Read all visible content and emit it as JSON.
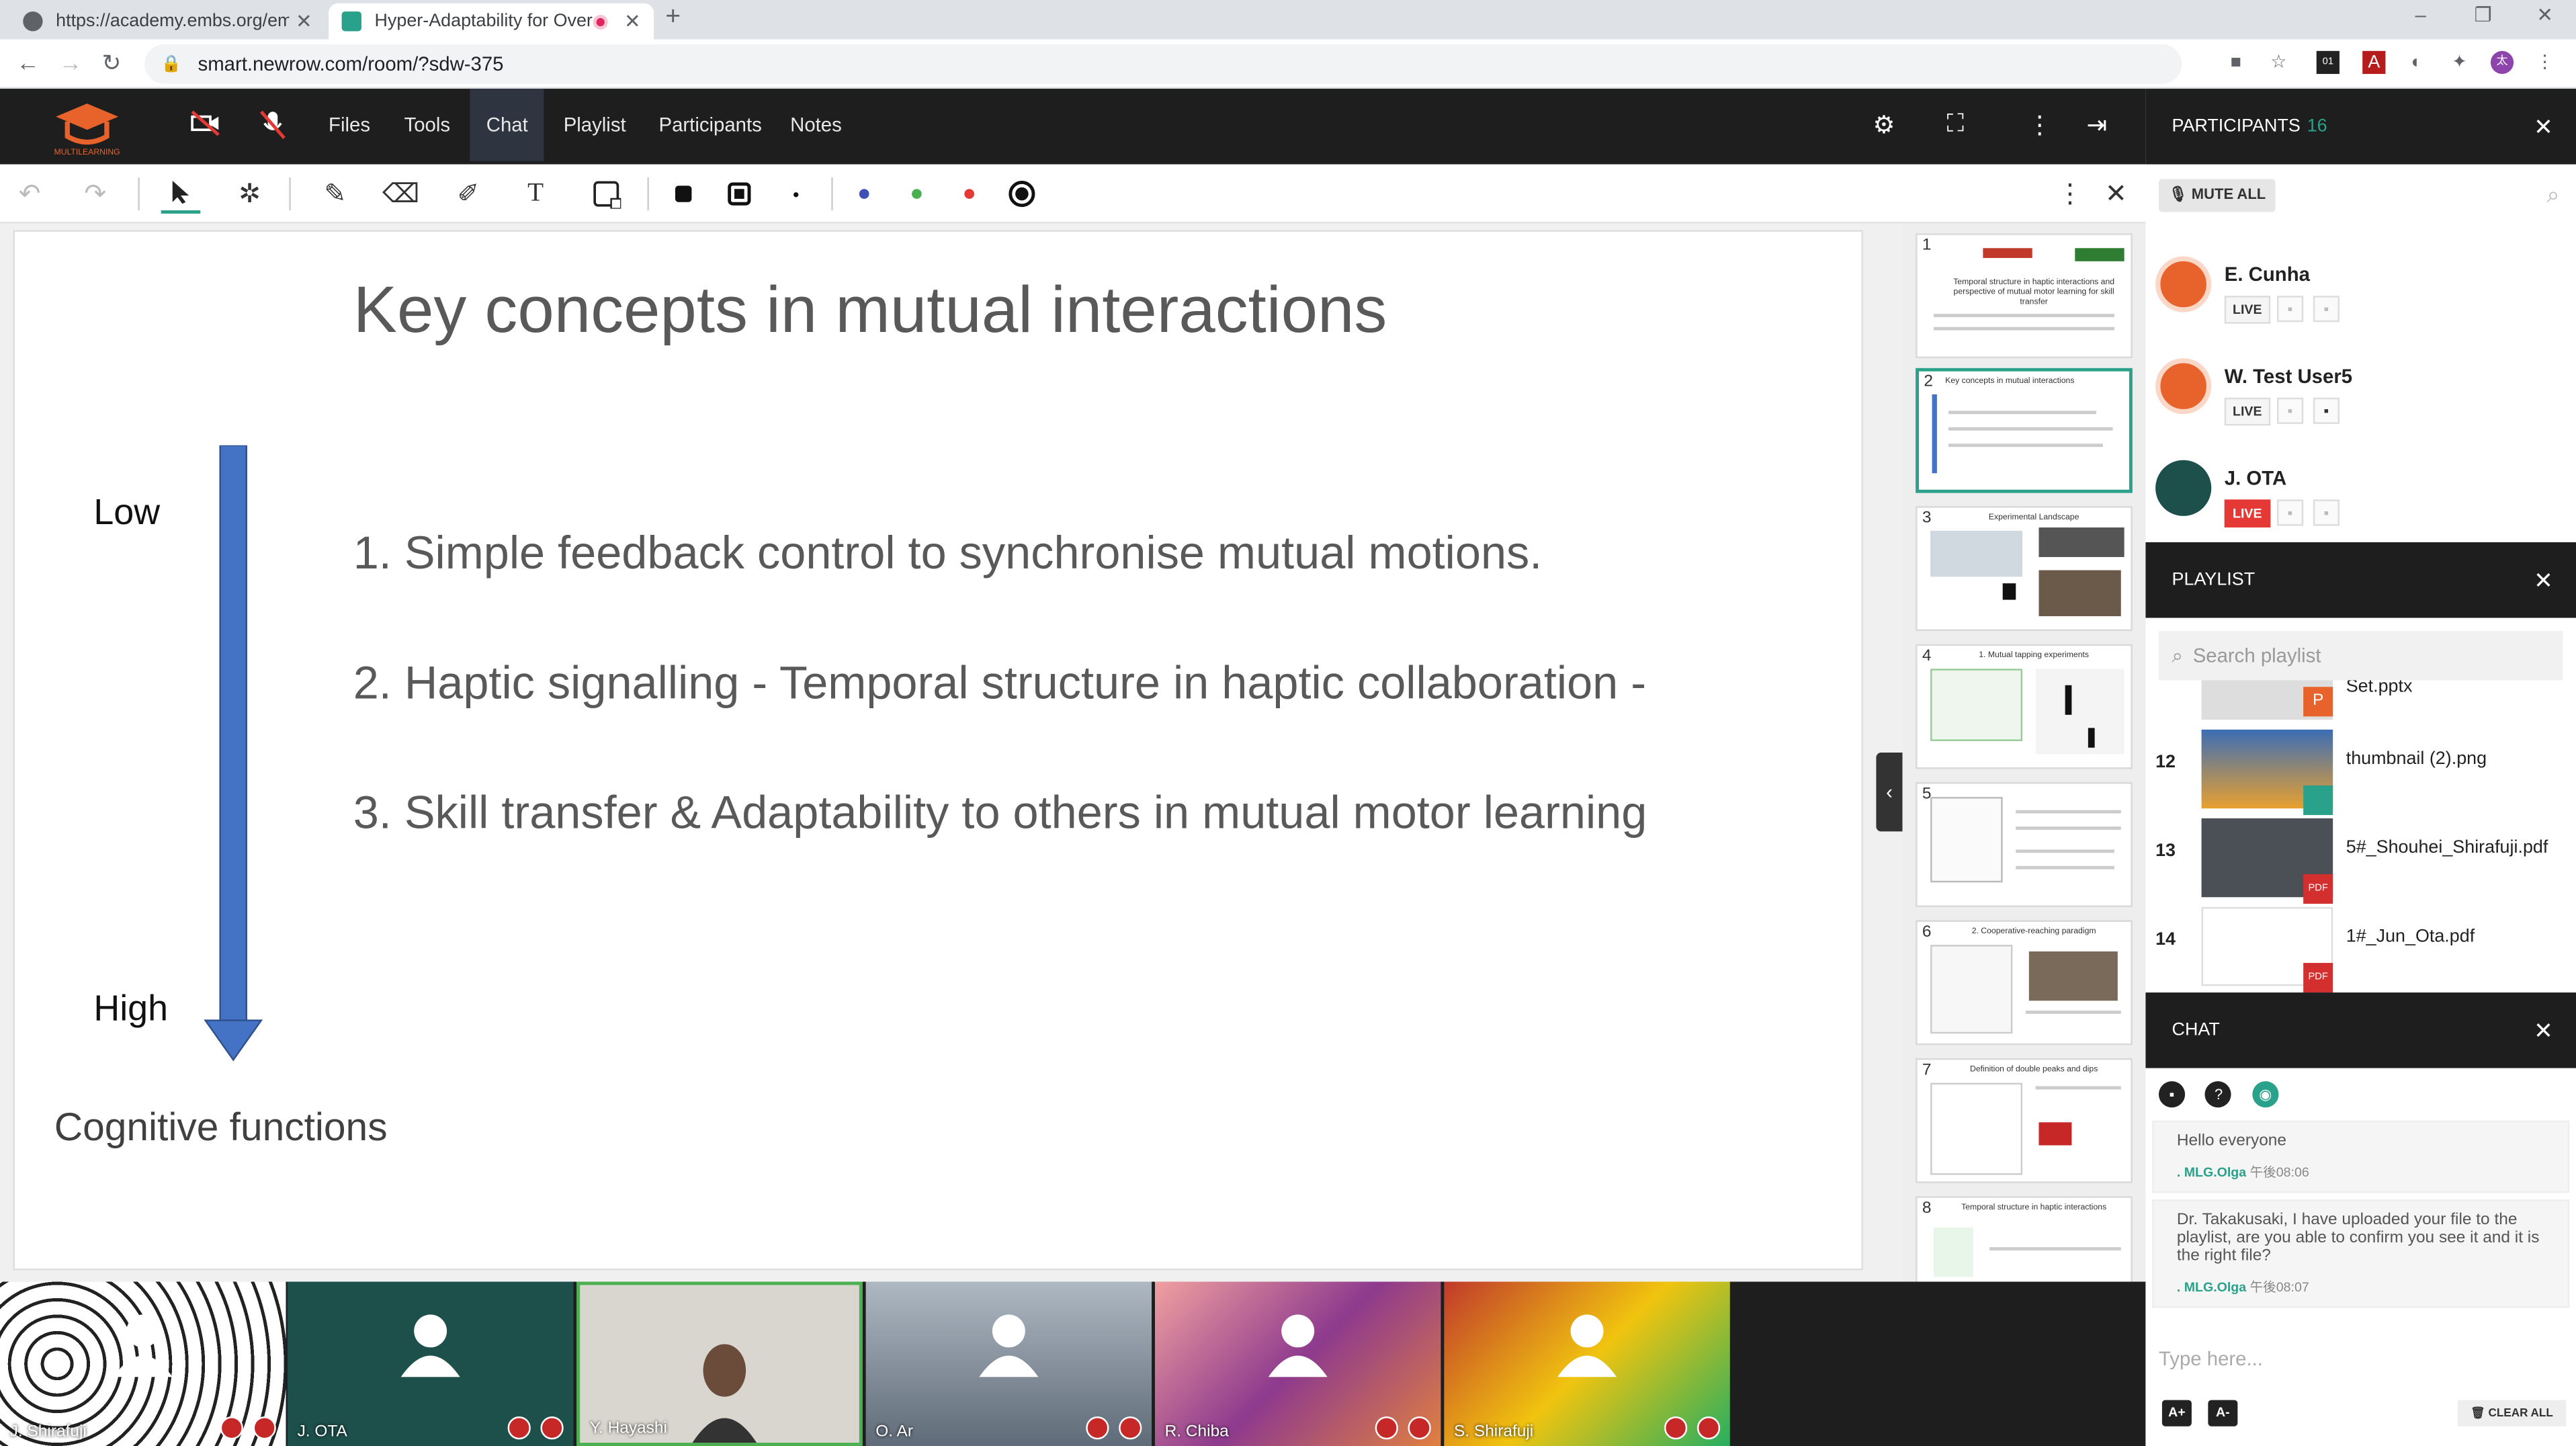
{
  "browser": {
    "tabs": [
      {
        "title": "https://academy.embs.org/embs",
        "close": "✕"
      },
      {
        "title": "Hyper-Adaptability for Over",
        "close": "✕"
      }
    ],
    "new_tab": "+",
    "url": "smart.newrow.com/room/?sdw-375",
    "window_controls": [
      "–",
      "❐",
      "✕"
    ]
  },
  "logo": {
    "text": "MULTILEARNING"
  },
  "appbar": {
    "menu": [
      "Files",
      "Tools",
      "Chat",
      "Playlist",
      "Participants",
      "Notes"
    ],
    "active": "Chat"
  },
  "slide": {
    "title": "Key concepts in mutual interactions",
    "items": [
      "1. Simple feedback control to synchronise mutual motions.",
      "2. Haptic signalling - Temporal structure in haptic collaboration -",
      "3. Skill transfer & Adaptability to others in mutual motor learning"
    ],
    "low": "Low",
    "high": "High",
    "footer": "Cognitive functions",
    "arrow_color": "#4472c4"
  },
  "thumbnails": [
    {
      "num": "1",
      "title": "Temporal structure in haptic interactions and perspective of mutual motor learning for skill transfer"
    },
    {
      "num": "2",
      "title": "Key concepts in mutual interactions"
    },
    {
      "num": "3",
      "title": "Experimental Landscape"
    },
    {
      "num": "4",
      "title": "1. Mutual tapping experiments"
    },
    {
      "num": "5",
      "title": ""
    },
    {
      "num": "6",
      "title": "2. Cooperative-reaching paradigm"
    },
    {
      "num": "7",
      "title": "Definition of double peaks and dips"
    },
    {
      "num": "8",
      "title": "Temporal structure in haptic interactions"
    }
  ],
  "videos": [
    {
      "name": "J. Shirafuji",
      "bg": "#f5f5f5"
    },
    {
      "name": "J. OTA",
      "bg": "#1d4f4b"
    },
    {
      "name": "Y. Hayashi",
      "bg": "#d9d6cf"
    },
    {
      "name": "O. Ar",
      "bg": "#7b8a99"
    },
    {
      "name": "R. Chiba",
      "bg": "#c9538a"
    },
    {
      "name": "S. Shirafuji",
      "bg": "#8bbf2a"
    }
  ],
  "participants": {
    "header": "PARTICIPANTS",
    "count": "16",
    "mute_all": "MUTE ALL",
    "list": [
      {
        "name": "E. Cunha",
        "live": "LIVE",
        "live_on": false
      },
      {
        "name": "W. Test User5",
        "live": "LIVE",
        "live_on": false
      },
      {
        "name": "J. OTA",
        "live": "LIVE",
        "live_on": true
      }
    ]
  },
  "playlist": {
    "header": "PLAYLIST",
    "search_placeholder": "Search playlist",
    "items": [
      {
        "num": "",
        "name": "Set.pptx",
        "type": "P"
      },
      {
        "num": "12",
        "name": "thumbnail (2).png",
        "type": ""
      },
      {
        "num": "13",
        "name": "5#_Shouhei_Shirafuji.pdf",
        "type": "PDF"
      },
      {
        "num": "14",
        "name": "1#_Jun_Ota.pdf",
        "type": "PDF"
      }
    ]
  },
  "chat": {
    "header": "CHAT",
    "messages": [
      {
        "text": "Hello everyone",
        "author": ". MLG.Olga",
        "time": "午後08:06"
      },
      {
        "text": "Dr. Takakusaki, I have uploaded your file to the playlist, are you able to confirm you see it and it is the right file?",
        "author": ". MLG.Olga",
        "time": "午後08:07"
      }
    ],
    "input_placeholder": "Type here...",
    "font_up": "A+",
    "font_down": "A-",
    "clear_all": "CLEAR ALL"
  },
  "colors": {
    "accent": "#2aa18a",
    "dark": "#1e1e1e",
    "live_red": "#e53935"
  }
}
